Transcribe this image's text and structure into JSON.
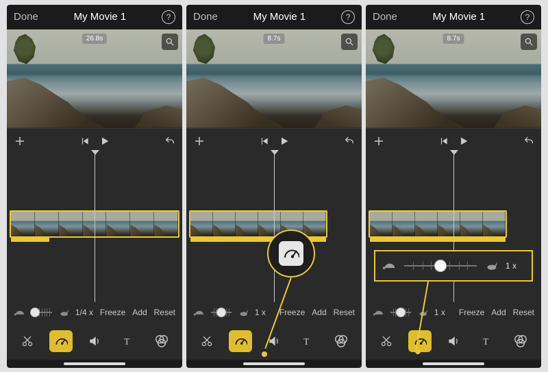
{
  "header": {
    "done": "Done",
    "title": "My Movie 1",
    "help": "?"
  },
  "panel1": {
    "duration_badge": "26.8s",
    "speed_label": "1/4 x",
    "freeze": "Freeze",
    "add": "Add",
    "reset": "Reset"
  },
  "panel2": {
    "duration_badge": "8.7s",
    "speed_label": "1 x",
    "freeze": "Freeze",
    "add": "Add",
    "reset": "Reset"
  },
  "panel3": {
    "duration_badge": "8.7s",
    "speed_label": "1 x",
    "freeze": "Freeze",
    "add": "Add",
    "reset": "Reset",
    "callout_speed_label": "1 x"
  },
  "slider": {
    "panel1_pos_pct": 18,
    "panel2_pos_pct": 50,
    "panel3_pos_pct": 50,
    "callout_pos_pct": 50
  },
  "icons": {
    "turtle": "turtle-icon",
    "rabbit": "rabbit-icon",
    "speedometer": "speedometer-icon"
  }
}
